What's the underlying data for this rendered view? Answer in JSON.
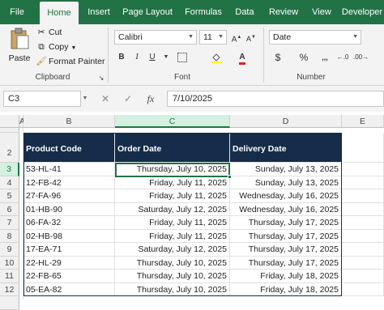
{
  "ribbon": {
    "tabs": [
      "File",
      "Home",
      "Insert",
      "Page Layout",
      "Formulas",
      "Data",
      "Review",
      "View",
      "Developer"
    ],
    "active_tab": "Home",
    "clipboard": {
      "paste": "Paste",
      "cut": "Cut",
      "copy": "Copy",
      "format_painter": "Format Painter",
      "label": "Clipboard"
    },
    "font": {
      "name": "Calibri",
      "size": "11",
      "label": "Font",
      "bold": "B",
      "italic": "I",
      "underline": "U"
    },
    "number": {
      "format": "Date",
      "label": "Number",
      "currency": "$",
      "percent": "%"
    }
  },
  "formula_bar": {
    "name_box": "C3",
    "fx": "fx",
    "value": "7/10/2025"
  },
  "grid": {
    "columns": [
      "A",
      "B",
      "C",
      "D",
      "E"
    ],
    "selected_column": "C",
    "selected_row": "3",
    "headers": [
      "Product Code",
      "Order Date",
      "Delivery Date"
    ],
    "rows": [
      {
        "num": "3",
        "code": "53-HL-41",
        "order": "Thursday, July 10, 2025",
        "delivery": "Sunday, July 13, 2025"
      },
      {
        "num": "4",
        "code": "12-FB-42",
        "order": "Friday, July 11, 2025",
        "delivery": "Sunday, July 13, 2025"
      },
      {
        "num": "5",
        "code": "27-FA-96",
        "order": "Friday, July 11, 2025",
        "delivery": "Wednesday, July 16, 2025"
      },
      {
        "num": "6",
        "code": "01-HB-90",
        "order": "Saturday, July 12, 2025",
        "delivery": "Wednesday, July 16, 2025"
      },
      {
        "num": "7",
        "code": "06-FA-32",
        "order": "Friday, July 11, 2025",
        "delivery": "Thursday, July 17, 2025"
      },
      {
        "num": "8",
        "code": "02-HB-98",
        "order": "Friday, July 11, 2025",
        "delivery": "Thursday, July 17, 2025"
      },
      {
        "num": "9",
        "code": "17-EA-71",
        "order": "Saturday, July 12, 2025",
        "delivery": "Thursday, July 17, 2025"
      },
      {
        "num": "10",
        "code": "22-HL-29",
        "order": "Thursday, July 10, 2025",
        "delivery": "Thursday, July 17, 2025"
      },
      {
        "num": "11",
        "code": "22-FB-65",
        "order": "Thursday, July 10, 2025",
        "delivery": "Friday, July 18, 2025"
      },
      {
        "num": "12",
        "code": "05-EA-82",
        "order": "Thursday, July 10, 2025",
        "delivery": "Friday, July 18, 2025"
      }
    ]
  },
  "colors": {
    "excel_green": "#217346",
    "header_fill": "#152d4a"
  }
}
